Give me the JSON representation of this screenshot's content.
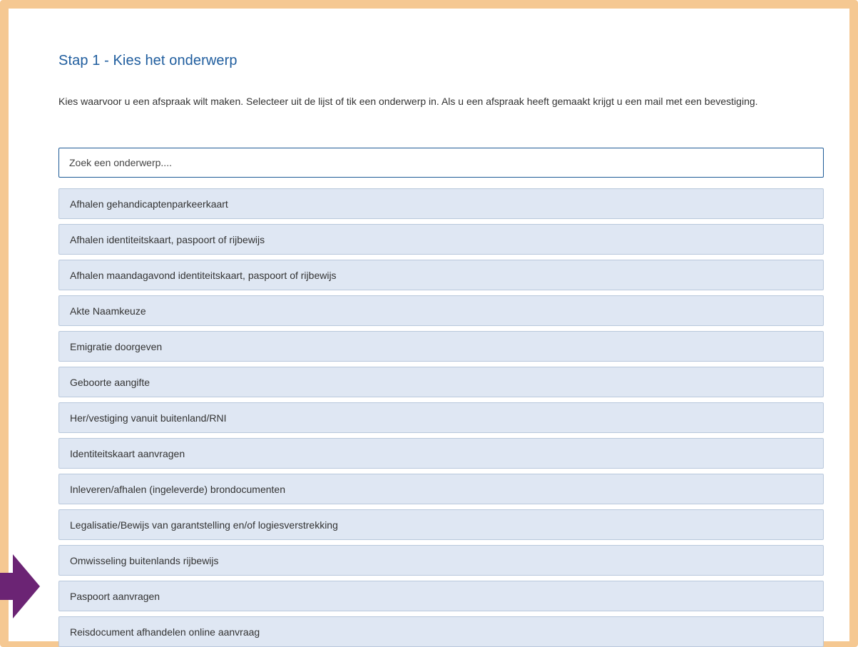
{
  "step": {
    "title": "Stap 1 - Kies het onderwerp",
    "intro": "Kies waarvoor u een afspraak wilt maken. Selecteer uit de lijst of tik een onderwerp in. Als u een afspraak heeft gemaakt krijgt u een mail met een bevestiging."
  },
  "search": {
    "placeholder": "Zoek een onderwerp....",
    "value": ""
  },
  "subjects": [
    "Afhalen gehandicaptenparkeerkaart",
    "Afhalen identiteitskaart, paspoort of rijbewijs",
    "Afhalen maandagavond identiteitskaart, paspoort of rijbewijs",
    "Akte Naamkeuze",
    "Emigratie doorgeven",
    "Geboorte aangifte",
    "Her/vestiging vanuit buitenland/RNI",
    "Identiteitskaart aanvragen",
    "Inleveren/afhalen (ingeleverde) brondocumenten",
    "Legalisatie/Bewijs van garantstelling en/of logiesverstrekking",
    "Omwisseling buitenlands rijbewijs",
    "Paspoort aanvragen",
    "Reisdocument afhandelen online aanvraag"
  ],
  "colors": {
    "frame": "#f5c892",
    "title": "#1f5d9e",
    "item_background": "#dfe7f3",
    "item_border": "#b9c8dc",
    "arrow": "#6b2474"
  },
  "annotation": {
    "icon": "arrow-right-icon",
    "points_to": "Paspoort aanvragen"
  }
}
